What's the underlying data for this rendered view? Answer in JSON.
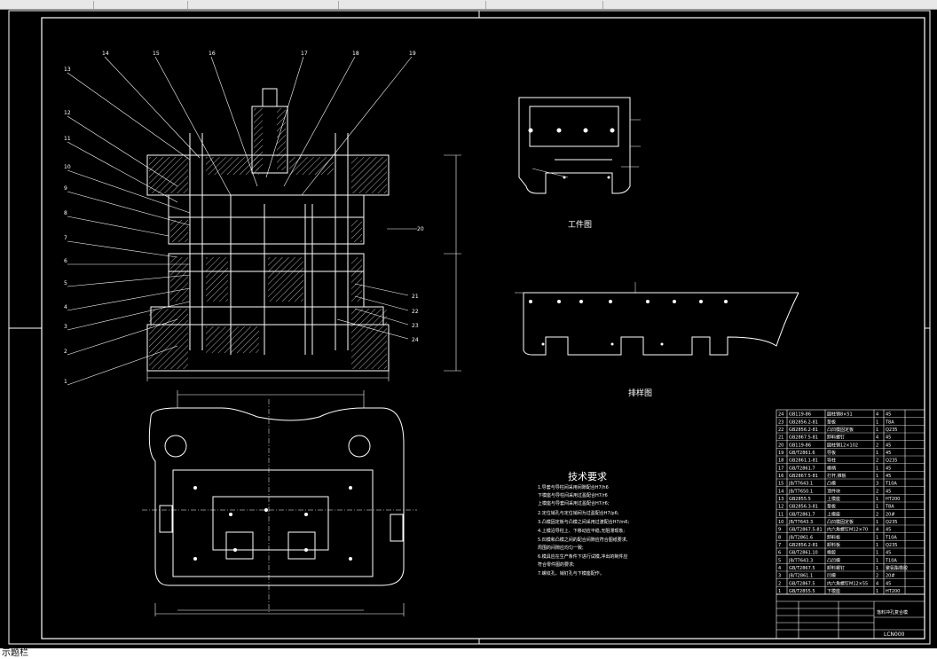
{
  "toolbar": {
    "segments": [
      "",
      "",
      "",
      "",
      ""
    ]
  },
  "status_bar": {
    "text": "示题栏"
  },
  "drawing": {
    "part_numbers_left": [
      "13",
      "12",
      "11",
      "10",
      "9",
      "8",
      "7",
      "6",
      "5",
      "4",
      "3",
      "2",
      "1"
    ],
    "part_numbers_top": [
      "14",
      "15",
      "16",
      "17",
      "18",
      "19"
    ],
    "part_numbers_right": [
      "20",
      "21",
      "22",
      "23",
      "24"
    ],
    "labels": {
      "workpiece": "工件图",
      "layout": "排样图"
    },
    "tech_requirements": {
      "title": "技术要求",
      "items": [
        "1.导套与导柱间采用间隙配合H7/h6",
        "  下模座与导柱间采用过盈配合H7/r6",
        "  上模座与导套间采用过盈配合H7/r6;",
        "2.定位销孔与定位销间为过盈配合H7/p6;",
        "3.凸模固定板与凸模之间采用过渡配合H7/m6;",
        "4.上模沿导柱上、下移动应平稳,无阻滞现象;",
        "5.凹模和凸模之间的配合间隙应符合图纸要求,",
        "  周围的间隙应均匀一致;",
        "6.模具应在生产条件下进行试模,冲出的制件应",
        "  符合零件图的要求;",
        "7.螺纹孔、销钉孔与下模座配作。"
      ]
    },
    "title_block": {
      "drawing_number": "LCN000",
      "title_right": "落料冲孔复合模"
    },
    "bom_rows": [
      [
        "24",
        "GB119-86",
        "圆柱销8×51",
        "4",
        "45"
      ],
      [
        "23",
        "GB2856.2-81",
        "垫板",
        "1",
        "T8A"
      ],
      [
        "22",
        "GB2856.2-81",
        "凸凹模固定板",
        "1",
        "Q235"
      ],
      [
        "21",
        "GB2867.5-81",
        "卸料螺钉",
        "4",
        "45"
      ],
      [
        "20",
        "GB119-86",
        "圆柱销12×102",
        "2",
        "45"
      ],
      [
        "19",
        "GB/T2861.6",
        "导板",
        "1",
        "45"
      ],
      [
        "18",
        "GB2861.1-81",
        "导柱",
        "2",
        "Q235"
      ],
      [
        "17",
        "GB/T2861.7",
        "模柄",
        "1",
        "45"
      ],
      [
        "16",
        "GB2867.5-81",
        "打杆,推板",
        "1",
        "45"
      ],
      [
        "15",
        "JB/T7643.1",
        "凸模",
        "3",
        "T10A"
      ],
      [
        "14",
        "JB/T7650.1",
        "顶件块",
        "2",
        "45"
      ],
      [
        "13",
        "GB2855.5",
        "上模座",
        "1",
        "HT200"
      ],
      [
        "12",
        "GB2856.3-81",
        "垫板",
        "1",
        "T8A"
      ],
      [
        "11",
        "GB/T2861.7",
        "上模座",
        "2",
        "20#"
      ],
      [
        "10",
        "JB/T7643.3",
        "凸凹模固定板",
        "1",
        "Q235"
      ],
      [
        "9",
        "GB/T2867.5-81",
        "内六角螺钉M12×70",
        "4",
        "45"
      ],
      [
        "8",
        "JB/T2861.6",
        "卸料板",
        "1",
        "T10A"
      ],
      [
        "7",
        "GB2856.2-81",
        "卸料板",
        "1",
        "Q235"
      ],
      [
        "6",
        "GB/T2861.10",
        "橡胶",
        "1",
        "45"
      ],
      [
        "5",
        "JB/T7643.3",
        "凸凹模",
        "1",
        "T10A"
      ],
      [
        "4",
        "GB/T2867.5",
        "卸料螺钉",
        "1",
        "聚氨酯橡胶"
      ],
      [
        "3",
        "JB/T2861.1",
        "凹模",
        "2",
        "20#"
      ],
      [
        "2",
        "GB/T2867.5",
        "内六角螺钉M12×55",
        "4",
        "45"
      ],
      [
        "1",
        "GB/T2855.5",
        "下模座",
        "1",
        "HT200"
      ]
    ]
  }
}
